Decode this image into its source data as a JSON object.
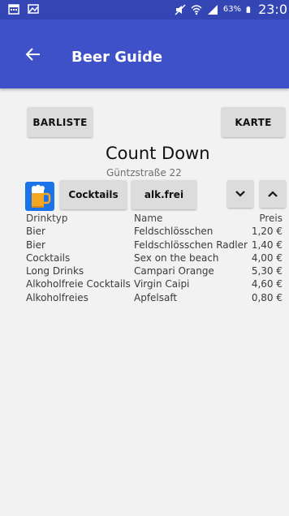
{
  "status_bar": {
    "battery_percent": "63%",
    "time": "23:0"
  },
  "app_bar": {
    "title": "Beer Guide"
  },
  "buttons": {
    "barliste": "BARLISTE",
    "karte": "KARTE",
    "cocktails": "Cocktails",
    "alkfrei": "alk.frei"
  },
  "bar": {
    "name": "Count Down",
    "address": "Güntzstraße 22",
    "extra": "--"
  },
  "table": {
    "headers": [
      "Drinktyp",
      "Name",
      "Preis"
    ],
    "rows": [
      [
        "Bier",
        "Feldschlösschen",
        "1,20 €"
      ],
      [
        "Bier",
        "Feldschlösschen Radler",
        "1,40 €"
      ],
      [
        "Cocktails",
        "Sex on the beach",
        "4,00 €"
      ],
      [
        "Long Drinks",
        "Campari Orange",
        "5,30 €"
      ],
      [
        "Alkoholfreie Cocktails",
        "Virgin Caipi",
        "4,60 €"
      ],
      [
        "Alkoholfreies",
        "Apfelsaft",
        "0,80 €"
      ]
    ]
  },
  "colors": {
    "status_bar": "#3446b4",
    "app_bar": "#3f51c8",
    "background": "#f2f2f2",
    "button": "#dcdcdc",
    "logo": "#1a73e8"
  },
  "icons": [
    "calendar-icon",
    "image-icon",
    "mute-icon",
    "wifi-icon",
    "signal-icon",
    "battery-icon",
    "back-arrow-icon",
    "beer-mug-icon",
    "chevron-down-icon",
    "chevron-up-icon"
  ]
}
